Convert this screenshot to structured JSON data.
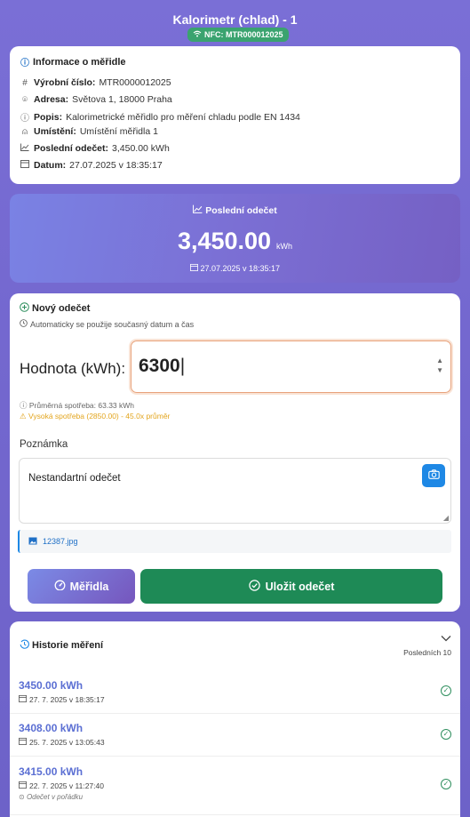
{
  "header": {
    "title": "Kalorimetr (chlad) - 1",
    "nfc_label": "NFC: MTR000012025"
  },
  "info": {
    "title": "Informace o měřidle",
    "rows": [
      {
        "label": "Výrobní číslo:",
        "value": "MTR0000012025",
        "icon": "hash-icon"
      },
      {
        "label": "Adresa:",
        "value": "Světova 1, 18000 Praha",
        "icon": "location-pin-icon"
      },
      {
        "label": "Popis:",
        "value": "Kalorimetrické měřidlo pro měření chladu podle EN 1434",
        "icon": "info-icon"
      },
      {
        "label": "Umístění:",
        "value": "Umístění měřidla 1",
        "icon": "user-icon"
      },
      {
        "label": "Poslední odečet:",
        "value": "3,450.00 kWh",
        "icon": "chart-line-icon"
      },
      {
        "label": "Datum:",
        "value": "27.07.2025 v 18:35:17",
        "icon": "calendar-icon"
      }
    ]
  },
  "last_reading": {
    "label": "Poslední odečet",
    "value": "3,450.00",
    "unit": "kWh",
    "date": "27.07.2025 v 18:35:17"
  },
  "new_reading": {
    "title": "Nový odečet",
    "subtitle": "Automaticky se použije současný datum a čas",
    "value_label": "Hodnota (kWh):",
    "value": "6300",
    "avg_hint": "Průměrná spotřeba: 63.33 kWh",
    "warning": "Vysoká spotřeba (2850.00) - 45.0x průměr",
    "note_label": "Poznámka",
    "note_value": "Nestandartní odečet",
    "attachment": "12387.jpg",
    "btn_meters": "Měřidla",
    "btn_save": "Uložit odečet"
  },
  "history": {
    "title": "Historie měření",
    "filter": "Posledních 10",
    "items": [
      {
        "value": "3450.00 kWh",
        "date": "27. 7. 2025 v 18:35:17",
        "note": ""
      },
      {
        "value": "3408.00 kWh",
        "date": "25. 7. 2025 v 13:05:43",
        "note": ""
      },
      {
        "value": "3415.00 kWh",
        "date": "22. 7. 2025 v 11:27:40",
        "note": "Odečet v pořádku"
      }
    ]
  },
  "colors": {
    "accent": "#5b6fd3",
    "success": "#1e8a56",
    "warning": "#e3a51e",
    "camera": "#1e88e5"
  }
}
